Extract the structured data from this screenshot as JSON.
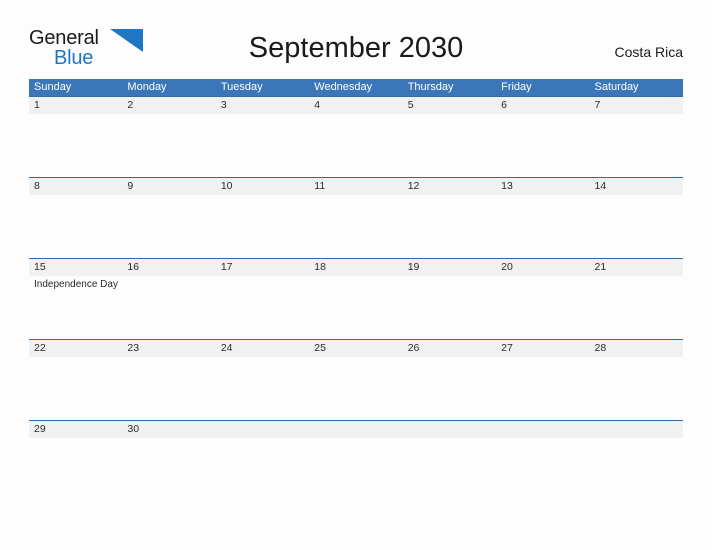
{
  "brand": {
    "word_one": "General",
    "word_two": "Blue",
    "flag_icon": "blue-flag-triangle-icon",
    "color_dark": "#1a1a1a",
    "color_blue": "#1f77c4"
  },
  "header": {
    "title": "September 2030",
    "region": "Costa Rica"
  },
  "colors": {
    "header_bar": "#3a76b8",
    "row_divider": "#2e6da4",
    "date_band": "#f1f1f1",
    "page_background": "#fdfdfd",
    "text": "#2b2b2b"
  },
  "calendar": {
    "month": "September",
    "year": "2030",
    "weekdays": [
      "Sunday",
      "Monday",
      "Tuesday",
      "Wednesday",
      "Thursday",
      "Friday",
      "Saturday"
    ],
    "weeks": [
      {
        "days": [
          {
            "number": "1",
            "events": []
          },
          {
            "number": "2",
            "events": []
          },
          {
            "number": "3",
            "events": []
          },
          {
            "number": "4",
            "events": []
          },
          {
            "number": "5",
            "events": []
          },
          {
            "number": "6",
            "events": []
          },
          {
            "number": "7",
            "events": []
          }
        ]
      },
      {
        "days": [
          {
            "number": "8",
            "events": []
          },
          {
            "number": "9",
            "events": []
          },
          {
            "number": "10",
            "events": []
          },
          {
            "number": "11",
            "events": []
          },
          {
            "number": "12",
            "events": []
          },
          {
            "number": "13",
            "events": []
          },
          {
            "number": "14",
            "events": []
          }
        ]
      },
      {
        "days": [
          {
            "number": "15",
            "events": [
              "Independence Day"
            ]
          },
          {
            "number": "16",
            "events": []
          },
          {
            "number": "17",
            "events": []
          },
          {
            "number": "18",
            "events": []
          },
          {
            "number": "19",
            "events": []
          },
          {
            "number": "20",
            "events": []
          },
          {
            "number": "21",
            "events": []
          }
        ]
      },
      {
        "days": [
          {
            "number": "22",
            "events": []
          },
          {
            "number": "23",
            "events": []
          },
          {
            "number": "24",
            "events": []
          },
          {
            "number": "25",
            "events": []
          },
          {
            "number": "26",
            "events": []
          },
          {
            "number": "27",
            "events": []
          },
          {
            "number": "28",
            "events": []
          }
        ]
      },
      {
        "days": [
          {
            "number": "29",
            "events": []
          },
          {
            "number": "30",
            "events": []
          },
          {
            "number": "",
            "events": []
          },
          {
            "number": "",
            "events": []
          },
          {
            "number": "",
            "events": []
          },
          {
            "number": "",
            "events": []
          },
          {
            "number": "",
            "events": []
          }
        ]
      }
    ]
  }
}
